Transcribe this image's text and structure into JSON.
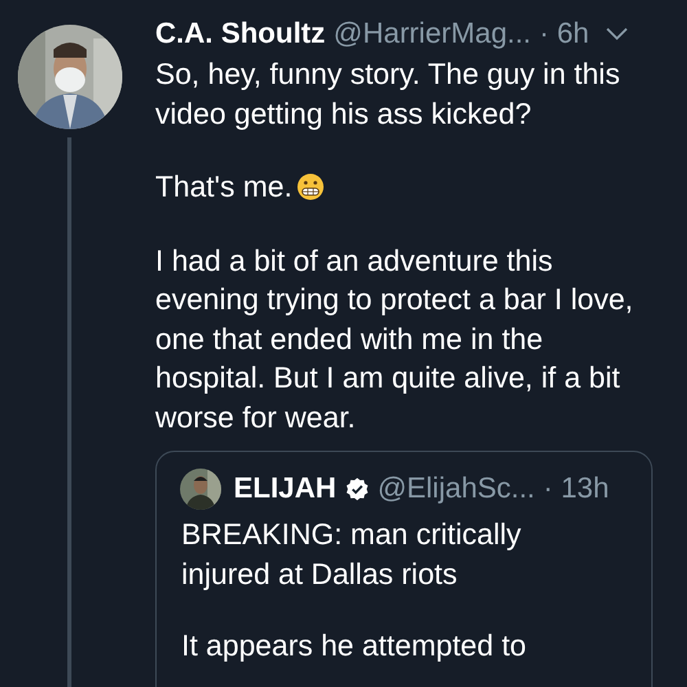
{
  "tweet": {
    "name": "C.A. Shoultz",
    "handle": "@HarrierMag...",
    "time": "· 6h",
    "paragraphs": [
      {
        "text": "So, hey, funny story. The guy in this video getting his ass kicked?",
        "emoji": false
      },
      {
        "text": "That's me.",
        "emoji": true
      },
      {
        "text": "I had a bit of an adventure this evening trying to protect a bar I love, one that ended with me in the hospital. But I am quite alive, if a bit worse for wear.",
        "emoji": false
      }
    ],
    "quote": {
      "name": "ELIJAH",
      "verified": true,
      "handle": "@ElijahSc...",
      "time": "· 13h",
      "paragraphs": [
        "BREAKING: man critically injured at Dallas riots",
        "It appears he attempted to"
      ]
    }
  }
}
